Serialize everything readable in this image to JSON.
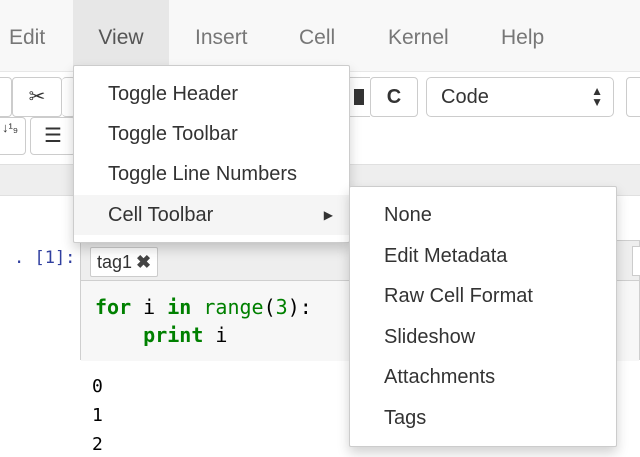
{
  "menubar": {
    "items": [
      {
        "label": "Edit"
      },
      {
        "label": "View"
      },
      {
        "label": "Insert"
      },
      {
        "label": "Cell"
      },
      {
        "label": "Kernel"
      },
      {
        "label": "Help"
      }
    ]
  },
  "toolbar": {
    "cut_icon": "✂",
    "restart_icon": "C",
    "cell_type": "Code",
    "sort_icon": "↓¹₉",
    "list_icon": "☰"
  },
  "view_menu": {
    "items": [
      {
        "label": "Toggle Header"
      },
      {
        "label": "Toggle Toolbar"
      },
      {
        "label": "Toggle Line Numbers"
      },
      {
        "label": "Cell Toolbar"
      }
    ]
  },
  "cell_toolbar_menu": {
    "items": [
      {
        "label": "None"
      },
      {
        "label": "Edit Metadata"
      },
      {
        "label": "Raw Cell Format"
      },
      {
        "label": "Slideshow"
      },
      {
        "label": "Attachments"
      },
      {
        "label": "Tags"
      }
    ]
  },
  "cell": {
    "prompt": ". [1]:",
    "tag": "tag1",
    "tag_remove": "✖",
    "code": {
      "line1": {
        "kw1": "for",
        "var": " i ",
        "kw2": "in",
        "fn": " range",
        "open": "(",
        "num": "3",
        "close": "):"
      },
      "line2": {
        "kw": "print",
        "var": " i"
      }
    },
    "outputs": [
      "0",
      "1",
      "2"
    ]
  }
}
